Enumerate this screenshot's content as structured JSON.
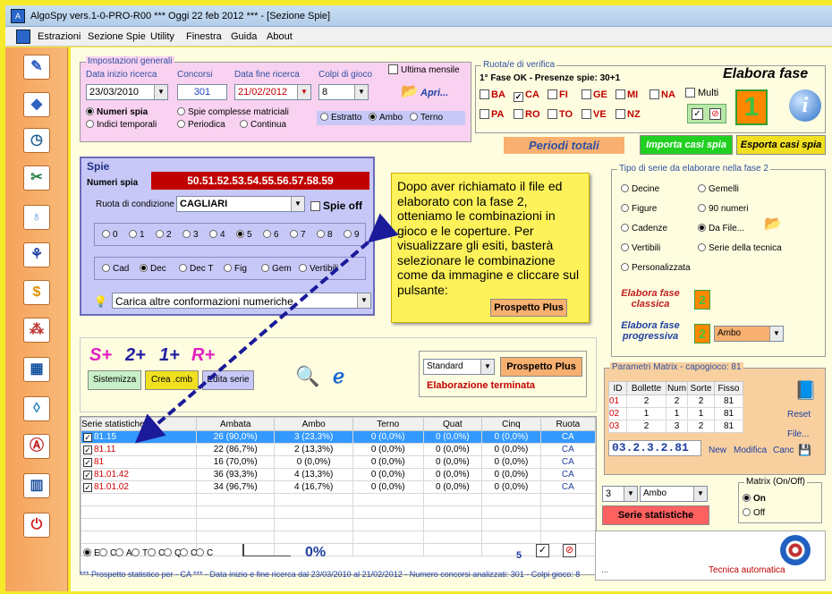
{
  "window": {
    "title": "AlgoSpy vers.1-0-PRO-R00  ***  Oggi 22 feb 2012  ***   - [Sezione Spie]"
  },
  "menu": [
    "Estrazioni",
    "Sezione Spie",
    "Utility",
    "Finestra",
    "Guida",
    "About"
  ],
  "imp": {
    "legend": "Impostazioni generali",
    "lbl_inizio": "Data inizio ricerca",
    "lbl_concorsi": "Concorsi",
    "lbl_fine": "Data fine ricerca",
    "lbl_colpi": "Colpi di gioco",
    "lbl_ultima": "Ultima mensile",
    "inizio": "23/03/2010",
    "concorsi": "301",
    "fine": "21/02/2012",
    "colpi": "8",
    "apri": "Apri...",
    "r1": "Numeri spia",
    "r2": "Spie complesse matriciali",
    "r3": "Indici temporali",
    "r4": "Periodica",
    "r5": "Continua",
    "e1": "Estratto",
    "e2": "Ambo",
    "e3": "Terno"
  },
  "ruota": {
    "legend": "Ruota/e di verifica",
    "status": "1° Fase OK - Presenze spie: 30+1",
    "row1": [
      "BA",
      "CA",
      "FI",
      "GE",
      "MI",
      "NA"
    ],
    "row2": [
      "PA",
      "RO",
      "TO",
      "VE",
      "NZ"
    ],
    "multi": "Multi",
    "elabora": "Elabora fase",
    "fase_num": "1",
    "periodi": "Periodi totali",
    "importa": "Importa casi spia",
    "esporta": "Esporta casi spia"
  },
  "spie": {
    "title": "Spie",
    "lbl_numeri": "Numeri spia",
    "numeri": "50.51.52.53.54.55.56.57.58.59",
    "lbl_ruota": "Ruota di condizione",
    "ruota": "CAGLIARI",
    "spie_off": "Spie off",
    "digits": [
      "0",
      "1",
      "2",
      "3",
      "4",
      "5",
      "6",
      "7",
      "8",
      "9"
    ],
    "types": [
      "Cad",
      "Dec",
      "Dec T",
      "Fig",
      "Gem",
      "Vertibili"
    ],
    "carica": "Carica altre conformazioni numeriche"
  },
  "callout": {
    "text": "Dopo aver richiamato il file ed elaborato con la fase 2, otteniamo le combinazioni in gioco e le coperture. Per visualizzare gli esiti, basterà selezionare le combinazione come da immagine e cliccare sul pulsante:",
    "button": "Prospetto Plus"
  },
  "serie": {
    "legend": "Tipo di serie da elaborare nella fase 2",
    "opts": [
      "Decine",
      "Gemelli",
      "Figure",
      "90 numeri",
      "Cadenze",
      "Da File...",
      "Vertibili",
      "Serie della tecnica",
      "Personalizzata"
    ],
    "classica": "Elabora fase classica",
    "progressiva": "Elabora fase progressiva",
    "fase2": "2",
    "progressiva_sel": "Ambo"
  },
  "mid": {
    "s": "S+",
    "due": "2+",
    "uno": "1+",
    "r": "R+",
    "sistemizza": "Sistemizza",
    "crea": "Crea .cmb",
    "edita": "Edita serie",
    "standard": "Standard",
    "prospetto": "Prospetto Plus",
    "status": "Elaborazione terminata"
  },
  "table": {
    "headers": [
      "Serie statistiche",
      "Ambata",
      "Ambo",
      "Terno",
      "Quat",
      "Cinq",
      "Ruota"
    ],
    "rows": [
      [
        "81.15",
        "26 (90,0%)",
        "3 (23,3%)",
        "0 (0,0%)",
        "0 (0,0%)",
        "0 (0,0%)",
        "CA"
      ],
      [
        "81.11",
        "22 (86,7%)",
        "2 (13,3%)",
        "0 (0,0%)",
        "0 (0,0%)",
        "0 (0,0%)",
        "CA"
      ],
      [
        "81",
        "16 (70,0%)",
        "0 (0,0%)",
        "0 (0,0%)",
        "0 (0,0%)",
        "0 (0,0%)",
        "CA"
      ],
      [
        "81.01.42",
        "36 (93,3%)",
        "4 (13,3%)",
        "0 (0,0%)",
        "0 (0,0%)",
        "0 (0,0%)",
        "CA"
      ],
      [
        "81.01.02",
        "34 (96,7%)",
        "4 (16,7%)",
        "0 (0,0%)",
        "0 (0,0%)",
        "0 (0,0%)",
        "CA"
      ]
    ]
  },
  "bottom": {
    "radios": [
      "E",
      "C",
      "A",
      "T",
      "C",
      "Q",
      "C",
      "C"
    ],
    "percent": "0%",
    "five": "5",
    "footer": "*** Prospetto statistico per  - CA *** - Data inizio e fine ricerca dal 23/03/2010 al 21/02/2012 - Numero concorsi analizzati: 301 - Colpi gioco: 8"
  },
  "matrix": {
    "legend": "Parametri Matrix - capogioco: 81",
    "headers": [
      "ID",
      "Bollette",
      "Num",
      "Sorte",
      "Fisso"
    ],
    "rows": [
      [
        "01",
        "2",
        "2",
        "2",
        "81"
      ],
      [
        "02",
        "1",
        "1",
        "1",
        "81"
      ],
      [
        "03",
        "2",
        "3",
        "2",
        "81"
      ]
    ],
    "reset": "Reset",
    "file": "File...",
    "code": "03.2.3.2.81",
    "new": "New",
    "modifica": "Modifica",
    "canc": "Canc",
    "sel_num": "3",
    "sel_sorte": "Ambo",
    "onoff": "Matrix (On/Off)",
    "on": "On",
    "off": "Off",
    "serie_btn": "Serie statistiche",
    "dots": "...",
    "tecnica": "Tecnica automatica"
  },
  "colors": {
    "accent": "#ff8800",
    "red": "#cc0000",
    "blue": "#0000cc"
  }
}
